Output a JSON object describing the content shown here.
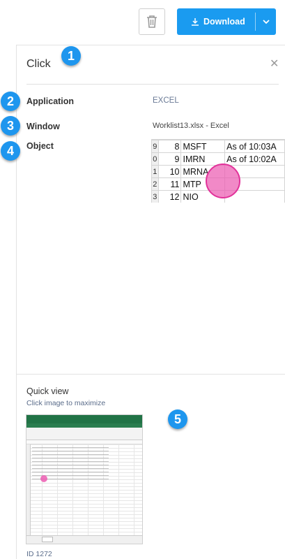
{
  "toolbar": {
    "download_label": "Download",
    "delete_icon": "trash-icon",
    "download_icon": "download-icon",
    "caret_icon": "chevron-down-icon"
  },
  "step": {
    "title": "Click",
    "close_icon": "close-icon"
  },
  "details": {
    "application_label": "Application",
    "application_value": "EXCEL",
    "window_label": "Window",
    "window_value": "Worklist13.xlsx - Excel",
    "object_label": "Object"
  },
  "object_rows": [
    {
      "row": "9",
      "num": "8",
      "ticker": "MSFT",
      "status": "As of 10:03A"
    },
    {
      "row": "0",
      "num": "9",
      "ticker": "IMRN",
      "status": "As of 10:02A"
    },
    {
      "row": "1",
      "num": "10",
      "ticker": "MRNA",
      "status": ""
    },
    {
      "row": "2",
      "num": "11",
      "ticker": "MTP",
      "status": ""
    },
    {
      "row": "3",
      "num": "12",
      "ticker": "NIO",
      "status": ""
    }
  ],
  "badges": [
    "1",
    "2",
    "3",
    "4",
    "5"
  ],
  "quick_view": {
    "title": "Quick view",
    "subtitle": "Click image to maximize",
    "id_text": "ID 1272"
  },
  "colors": {
    "accent": "#1a9bf0",
    "badge": "#1e96ee",
    "click_marker": "#ec5cb2",
    "excel_green": "#217346"
  }
}
